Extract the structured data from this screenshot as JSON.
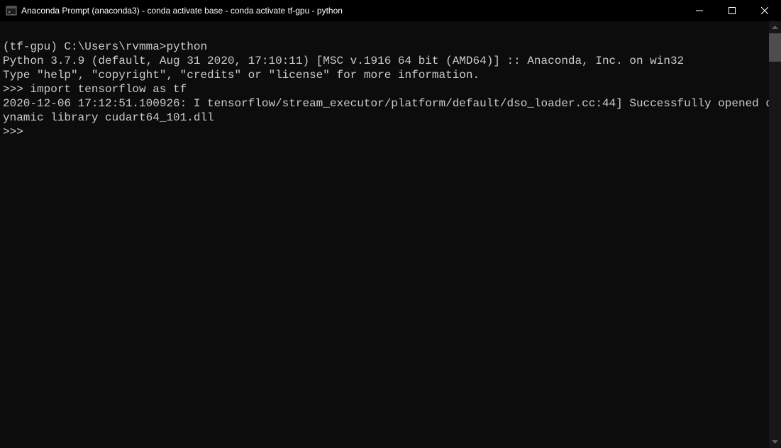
{
  "titlebar": {
    "title": "Anaconda Prompt (anaconda3) - conda  activate base - conda  activate tf-gpu - python"
  },
  "terminal": {
    "lines": [
      "",
      "(tf-gpu) C:\\Users\\rvmma>python",
      "Python 3.7.9 (default, Aug 31 2020, 17:10:11) [MSC v.1916 64 bit (AMD64)] :: Anaconda, Inc. on win32",
      "Type \"help\", \"copyright\", \"credits\" or \"license\" for more information.",
      ">>> import tensorflow as tf",
      "2020-12-06 17:12:51.100926: I tensorflow/stream_executor/platform/default/dso_loader.cc:44] Successfully opened dynamic library cudart64_101.dll",
      ">>>"
    ]
  }
}
